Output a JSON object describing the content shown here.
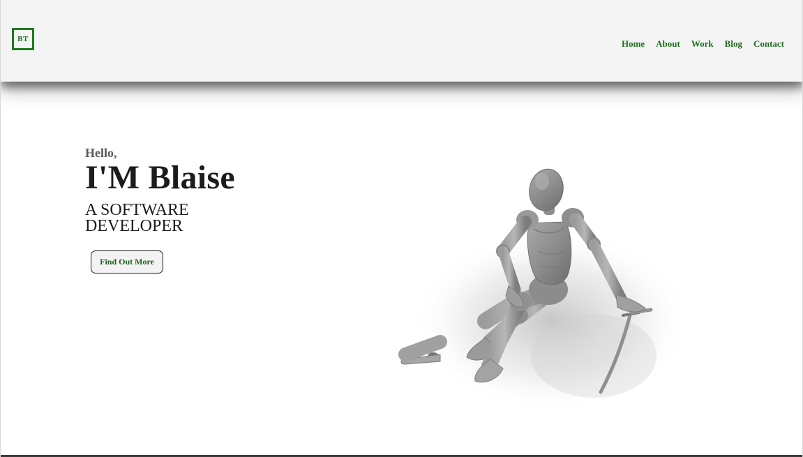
{
  "header": {
    "logo_text": "BT",
    "nav": [
      {
        "label": "Home"
      },
      {
        "label": "About"
      },
      {
        "label": "Work"
      },
      {
        "label": "Blog"
      },
      {
        "label": "Contact"
      }
    ]
  },
  "hero": {
    "greeting": "Hello,",
    "name": "I'M Blaise",
    "role": "A SOFTWARE DEVELOPER",
    "cta_label": "Find Out More",
    "image_icon": "wooden-mannequin-with-sword"
  },
  "colors": {
    "accent": "#1f6e1f",
    "header_bg": "#f4f4f4",
    "page_bg": "#ffffff",
    "heading": "#1c1c1c"
  }
}
